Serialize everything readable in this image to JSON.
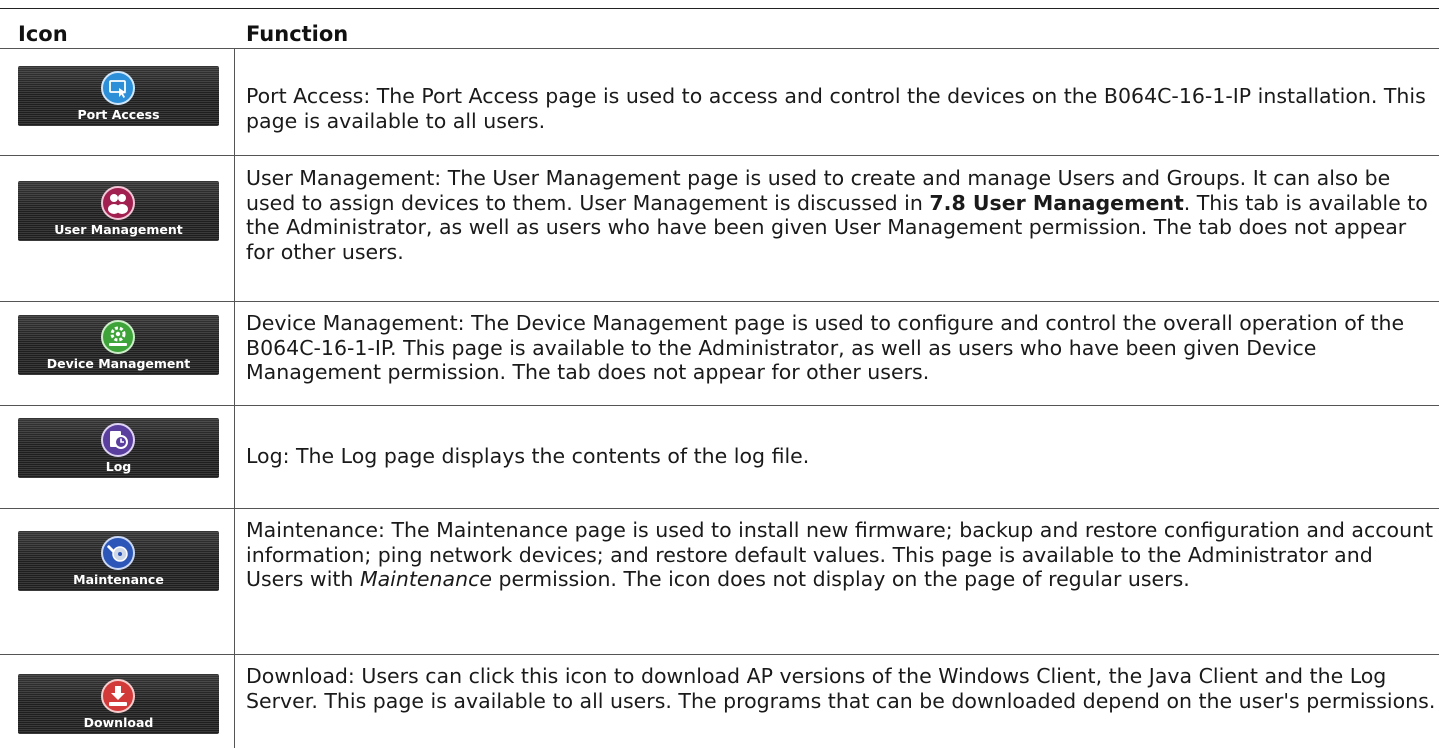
{
  "header": {
    "icon": "Icon",
    "function": "Function"
  },
  "rows": [
    {
      "icon": "port-access-icon",
      "color": "#2d8fd8",
      "label": "Port Access",
      "text": "Port Access: The Port Access page is used to access and control the devices on the B064C-16-1-IP installation. This page is available to all users."
    },
    {
      "icon": "user-management-icon",
      "color": "#a1204f",
      "label": "User Management",
      "text_a": "User Management: The User Management page is used to create and manage Users and Groups. It can also be used to assign devices to them. User Management is discussed in ",
      "text_bold": "7.8 User Management",
      "text_b": ". This tab is available to the Administrator, as well as users who have been given User Management permission. The tab does not appear for other users."
    },
    {
      "icon": "device-management-icon",
      "color": "#3ea43a",
      "label": "Device Management",
      "text": "Device Management: The Device Management page is used to configure and control the overall operation of the B064C-16-1-IP. This page is available to the Administrator, as well as users who have been given Device Management permission. The tab does not appear for other users."
    },
    {
      "icon": "log-icon",
      "color": "#5a3f9e",
      "label": "Log",
      "text": "Log: The Log page displays the contents of the log file."
    },
    {
      "icon": "maintenance-icon",
      "color": "#2c56b8",
      "label": "Maintenance",
      "text_a": "Maintenance: The Maintenance page is used to install new firmware; backup and restore configuration and account information; ping network devices; and restore default values. This page is available to the Administrator and Users with ",
      "text_italic": "Maintenance",
      "text_b": " permission. The icon does not display on the page of regular users."
    },
    {
      "icon": "download-icon",
      "color": "#d23a3a",
      "label": "Download",
      "text": "Download: Users can click this icon to download AP versions of the Windows Client, the Java Client and the Log Server. This page is available to all users. The programs that can be downloaded depend on the user's permissions."
    }
  ]
}
